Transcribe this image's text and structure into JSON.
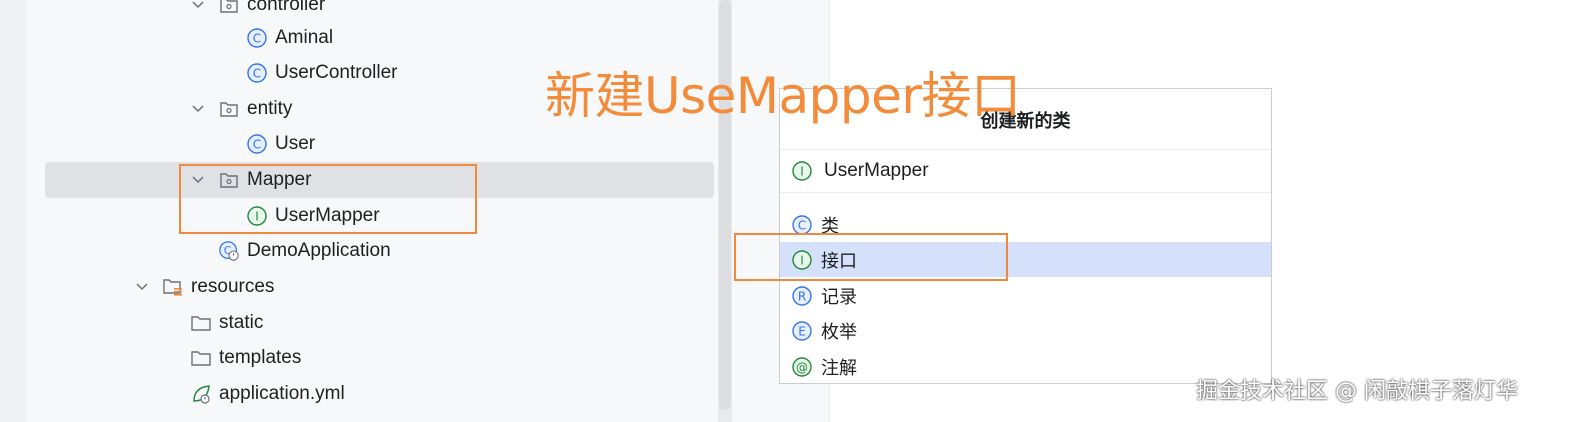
{
  "tree": {
    "items": [
      {
        "label": "controller",
        "icon": "package-folder-icon"
      },
      {
        "label": "Aminal",
        "icon": "class-icon"
      },
      {
        "label": "UserController",
        "icon": "class-icon"
      },
      {
        "label": "entity",
        "icon": "package-folder-icon"
      },
      {
        "label": "User",
        "icon": "class-icon"
      },
      {
        "label": "Mapper",
        "icon": "package-folder-icon",
        "selected": true
      },
      {
        "label": "UserMapper",
        "icon": "interface-icon"
      },
      {
        "label": "DemoApplication",
        "icon": "spring-boot-class-icon"
      },
      {
        "label": "resources",
        "icon": "resources-folder-icon"
      },
      {
        "label": "static",
        "icon": "folder-icon"
      },
      {
        "label": "templates",
        "icon": "folder-icon"
      },
      {
        "label": "application.yml",
        "icon": "spring-config-icon"
      }
    ]
  },
  "annotation": {
    "title": "新建UseMapper接口",
    "color": "#f28c3a"
  },
  "dialog": {
    "title": "创建新的类",
    "input_value": "UserMapper",
    "input_icon": "interface-icon",
    "options": [
      {
        "label": "类",
        "icon": "class-icon"
      },
      {
        "label": "接口",
        "icon": "interface-icon",
        "active": true
      },
      {
        "label": "记录",
        "icon": "record-icon"
      },
      {
        "label": "枚举",
        "icon": "enum-icon"
      },
      {
        "label": "注解",
        "icon": "annotation-icon"
      }
    ]
  },
  "colors": {
    "highlight": "#f0883e",
    "class_blue": "#3574f0",
    "interface_green": "#208a3c",
    "selection": "#d5e1fb"
  },
  "watermark": {
    "text": "掘金技术社区 @ 闲敲棋子落灯华"
  }
}
